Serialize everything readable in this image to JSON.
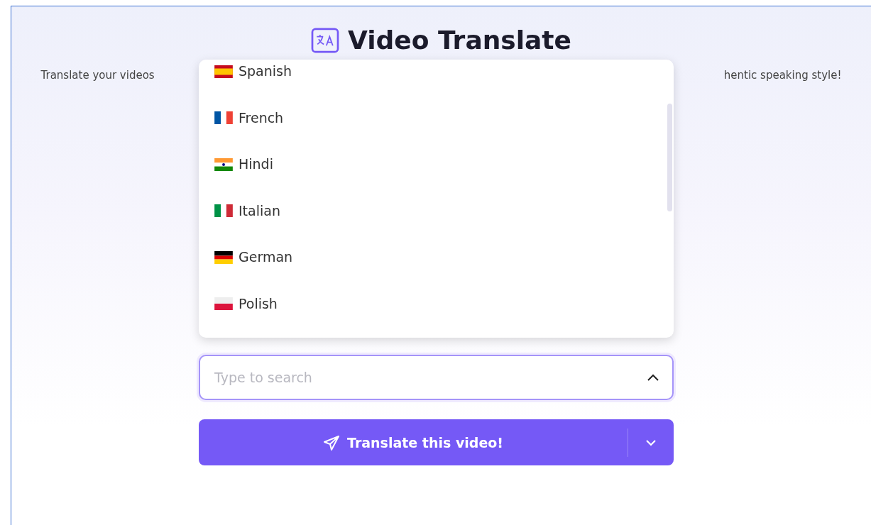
{
  "header": {
    "title": "Video Translate",
    "subtitle_left": "Translate your videos",
    "subtitle_right": "hentic speaking style!"
  },
  "language_menu": {
    "items": [
      {
        "label": "Spanish",
        "kind": "es",
        "selected": false
      },
      {
        "label": "French",
        "kind": "fr",
        "selected": false
      },
      {
        "label": "Hindi",
        "kind": "in",
        "selected": false
      },
      {
        "label": "Italian",
        "kind": "it",
        "selected": false
      },
      {
        "label": "German",
        "kind": "de",
        "selected": false
      },
      {
        "label": "Polish",
        "kind": "pl",
        "selected": false
      }
    ]
  },
  "search": {
    "placeholder": "Type to search",
    "expanded": true
  },
  "translate_button": {
    "label": "Translate this video!"
  }
}
